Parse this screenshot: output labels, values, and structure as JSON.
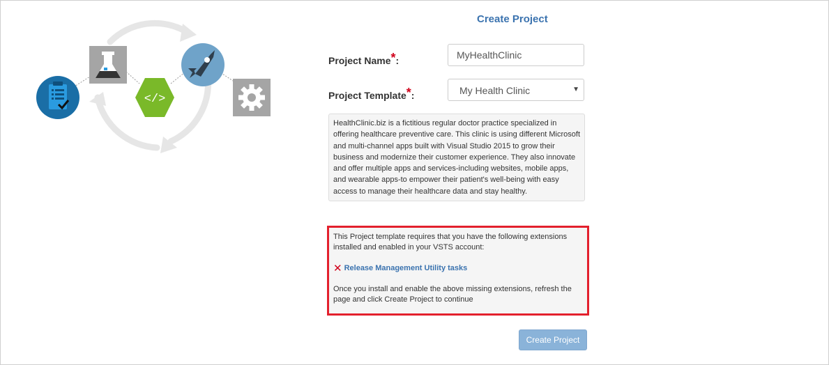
{
  "form": {
    "title": "Create Project",
    "project_name_label": "Project Name",
    "project_name_value": "MyHealthClinic",
    "required_marker": "*",
    "colon": ":",
    "project_template_label": "Project Template",
    "project_template_value": "My Health Clinic",
    "description": "HealthClinic.biz is a fictitious regular doctor practice specialized in offering healthcare preventive care. This clinic is using different Microsoft and multi-channel apps built with Visual Studio 2015 to grow their business and modernize their customer experience. They also innovate and offer multiple apps and services-including websites, mobile apps, and wearable apps-to empower their patient's well-being with easy access to manage their healthcare data and stay healthy."
  },
  "extensions": {
    "requirement_text": "This Project template requires that you have the following extensions installed and enabled in your VSTS account:",
    "missing": [
      {
        "icon": "x-icon",
        "name": "Release Management Utility tasks"
      }
    ],
    "after_text": "Once you install and enable the above missing extensions, refresh the page and click Create Project to continue"
  },
  "actions": {
    "create_label": "Create Project"
  },
  "illustration": {
    "icons": [
      "clipboard-check-icon",
      "flask-icon",
      "code-icon",
      "rocket-icon",
      "gear-icon"
    ],
    "colors": {
      "blue": "#1e7bb6",
      "gray": "#a5a5a5",
      "green": "#7ab929",
      "rocket_bg": "#6fa3c9",
      "arrows": "#e8e8e8"
    }
  }
}
